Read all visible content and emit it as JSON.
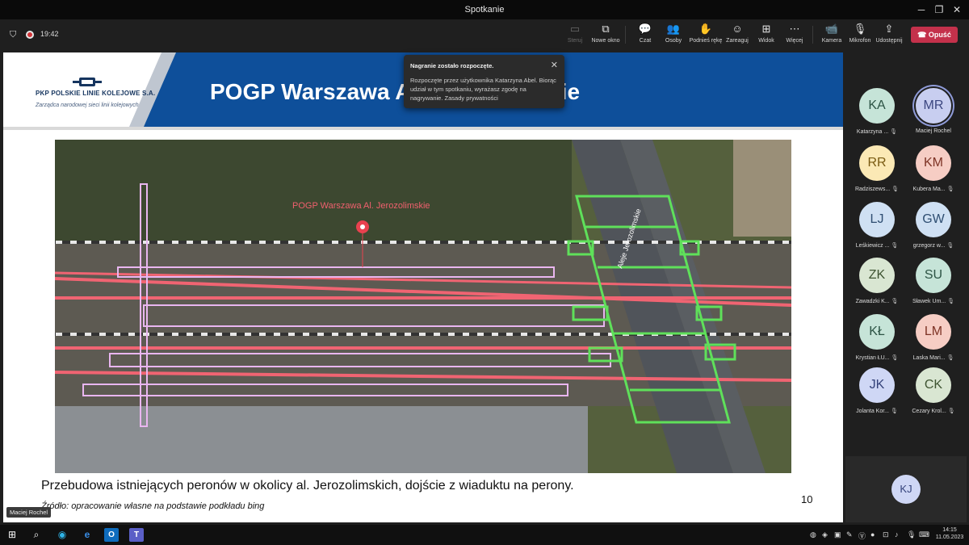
{
  "window": {
    "title": "Spotkanie"
  },
  "meeting_bar": {
    "time": "19:42",
    "items": [
      {
        "label": "Steruj",
        "icon": "screen-control-icon"
      },
      {
        "label": "Nowe okno",
        "icon": "new-window-icon"
      },
      {
        "label": "Czat",
        "icon": "chat-icon"
      },
      {
        "label": "Osoby",
        "icon": "people-icon"
      },
      {
        "label": "Podnieś rękę",
        "icon": "raise-hand-icon"
      },
      {
        "label": "Zareaguj",
        "icon": "react-icon"
      },
      {
        "label": "Widok",
        "icon": "view-icon"
      },
      {
        "label": "Więcej",
        "icon": "more-icon"
      },
      {
        "label": "Kamera",
        "icon": "camera-icon"
      },
      {
        "label": "Mikrofon",
        "icon": "microphone-icon"
      },
      {
        "label": "Udostępnij",
        "icon": "share-icon"
      }
    ],
    "leave_label": "Opuść"
  },
  "toast": {
    "title": "Nagranie zostało rozpoczęte.",
    "body": "Rozpoczęte przez użytkownika Katarzyna Abel. Biorąc udział w tym spotkaniu, wyrażasz zgodę na nagrywanie. Zasady prywatności"
  },
  "slide": {
    "company_name": "PKP POLSKIE LINIE KOLEJOWE S.A.",
    "company_tagline": "Zarządca narodowej sieci linii kolejowych",
    "title": "POGP Warszawa Al. Jerozolimskie",
    "map_label": "POGP Warszawa Al. Jerozolimskie",
    "street_label": "Aleje Jerozolimskie",
    "caption": "Przebudowa istniejących peronów w okolicy al. Jerozolimskich, dojście z wiaduktu na perony.",
    "source": "Źródło: opracowanie własne na podstawie podkładu bing",
    "page_number": "10"
  },
  "participants": [
    {
      "initials": "KA",
      "name": "Katarzyna ...",
      "color": "#c6e4d8"
    },
    {
      "initials": "MR",
      "name": "Maciej Rochel",
      "color": "#c8cef0",
      "speaking": true
    },
    {
      "initials": "RR",
      "name": "Radziszews...",
      "color": "#fbe9b5"
    },
    {
      "initials": "KM",
      "name": "Kubera Ma...",
      "color": "#f6cdc4"
    },
    {
      "initials": "LJ",
      "name": "Leśkiewicz ...",
      "color": "#cfe0f3"
    },
    {
      "initials": "GW",
      "name": "grzegorz w...",
      "color": "#cfe0f3"
    },
    {
      "initials": "ZK",
      "name": "Zawadzki K...",
      "color": "#d9e6d2"
    },
    {
      "initials": "SU",
      "name": "Sławek Um...",
      "color": "#c6e4d8"
    },
    {
      "initials": "KŁ",
      "name": "Krystian ŁU...",
      "color": "#c6e4d8"
    },
    {
      "initials": "LM",
      "name": "Laska Mari...",
      "color": "#f6cdc4"
    },
    {
      "initials": "JK",
      "name": "Jolanta Kor...",
      "color": "#cfd7f5"
    },
    {
      "initials": "CK",
      "name": "Cezary Krol...",
      "color": "#d9e6d2"
    }
  ],
  "self_view": {
    "initials": "KJ",
    "color": "#cfd7f5"
  },
  "presenter_tag": "Maciej Rochel",
  "taskbar": {
    "time": "14:15",
    "date": "11.05.2023"
  }
}
